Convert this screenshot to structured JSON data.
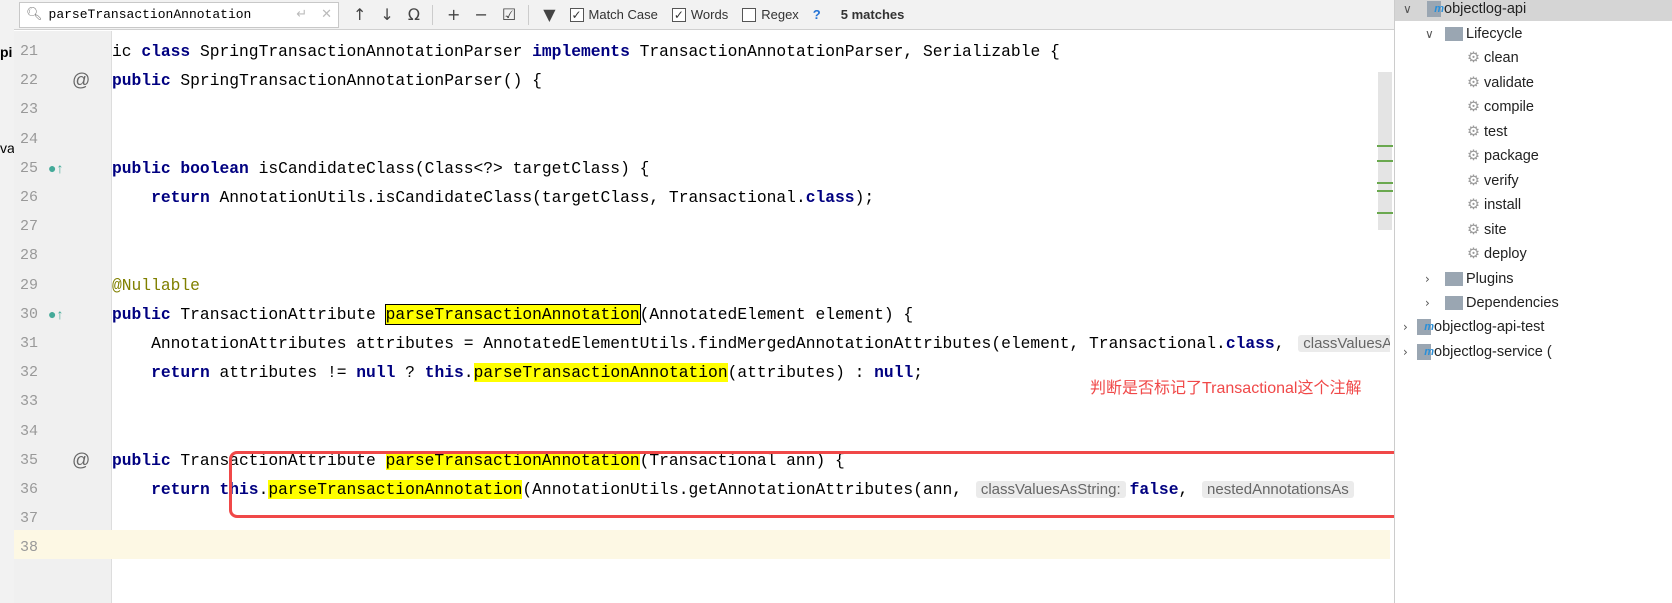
{
  "find_bar": {
    "query": "parseTransactionAnnotation",
    "match_case": {
      "label": "Match Case",
      "checked": true
    },
    "words": {
      "label": "Words",
      "checked": true
    },
    "regex": {
      "label": "Regex",
      "checked": false
    },
    "help": "?",
    "matches": "5 matches"
  },
  "left_strip": [
    "pi",
    "va"
  ],
  "code": [
    {
      "n": "21",
      "segs": [
        [
          "ic ",
          ""
        ],
        [
          "class",
          "kw"
        ],
        [
          " SpringTransactionAnnotationParser ",
          ""
        ],
        [
          "implements",
          "kw"
        ],
        [
          " TransactionAnnotationParser, Serializable {",
          ""
        ]
      ]
    },
    {
      "n": "22",
      "icon": "@",
      "segs": [
        [
          "public",
          "kw"
        ],
        [
          " SpringTransactionAnnotationParser() {",
          ""
        ]
      ]
    },
    {
      "n": "23",
      "segs": []
    },
    {
      "n": "24",
      "segs": []
    },
    {
      "n": "25",
      "icon": "implementing-method",
      "segs": [
        [
          "public boolean",
          "kw"
        ],
        [
          " isCandidateClass(Class<?> targetClass) {",
          ""
        ]
      ]
    },
    {
      "n": "26",
      "segs": [
        [
          "    ",
          ""
        ],
        [
          "return",
          "kw"
        ],
        [
          " AnnotationUtils.isCandidateClass(targetClass, Transactional.",
          ""
        ],
        [
          "class",
          "kw"
        ],
        [
          ");",
          ""
        ]
      ]
    },
    {
      "n": "27",
      "segs": []
    },
    {
      "n": "28",
      "segs": []
    },
    {
      "n": "29",
      "segs": [
        [
          "@Nullable",
          "ann"
        ]
      ]
    },
    {
      "n": "30",
      "icon": "implementing-method",
      "segs": [
        [
          "public",
          "kw"
        ],
        [
          " TransactionAttribute ",
          ""
        ],
        [
          "parseTransactionAnnotation",
          "hlbox"
        ],
        [
          "(AnnotatedElement element) {",
          ""
        ]
      ]
    },
    {
      "n": "31",
      "segs": [
        [
          "    AnnotationAttributes attributes = AnnotatedElementUtils.findMergedAnnotationAttributes(element, Transactional.",
          ""
        ],
        [
          "class",
          "kw"
        ],
        [
          ", ",
          ""
        ],
        [
          "classValuesAsString:",
          "hint"
        ]
      ]
    },
    {
      "n": "32",
      "segs": [
        [
          "    ",
          ""
        ],
        [
          "return",
          "kw"
        ],
        [
          " attributes != ",
          ""
        ],
        [
          "null",
          "kw"
        ],
        [
          " ? ",
          ""
        ],
        [
          "this",
          "kw"
        ],
        [
          ".",
          ""
        ],
        [
          "parseTransactionAnnotation",
          "hl"
        ],
        [
          "(attributes) : ",
          ""
        ],
        [
          "null",
          "kw"
        ],
        [
          ";",
          ""
        ]
      ]
    },
    {
      "n": "33",
      "segs": []
    },
    {
      "n": "34",
      "segs": []
    },
    {
      "n": "35",
      "icon": "@",
      "segs": [
        [
          "public",
          "kw"
        ],
        [
          " TransactionAttribute ",
          ""
        ],
        [
          "parseTransactionAnnotation",
          "hl"
        ],
        [
          "(Transactional ann) {",
          ""
        ]
      ]
    },
    {
      "n": "36",
      "segs": [
        [
          "    ",
          ""
        ],
        [
          "return this",
          "kw"
        ],
        [
          ".",
          ""
        ],
        [
          "parseTransactionAnnotation",
          "hl"
        ],
        [
          "(AnnotationUtils.getAnnotationAttributes(ann, ",
          ""
        ],
        [
          "classValuesAsString:",
          "hint"
        ],
        [
          "false",
          "kw"
        ],
        [
          ", ",
          ""
        ],
        [
          "nestedAnnotationsAs",
          "hint"
        ]
      ]
    },
    {
      "n": "37",
      "segs": []
    },
    {
      "n": "38",
      "segs": []
    }
  ],
  "annotation_note": "判断是否标记了Transactional这个注解",
  "maven_tree": {
    "root": "objectlog-api",
    "lifecycle": {
      "label": "Lifecycle",
      "goals": [
        "clean",
        "validate",
        "compile",
        "test",
        "package",
        "verify",
        "install",
        "site",
        "deploy"
      ]
    },
    "plugins": "Plugins",
    "dependencies": "Dependencies",
    "siblings": [
      "objectlog-api-test",
      "objectlog-service ("
    ]
  },
  "colors": {
    "highlight": "#ffff00",
    "keyword": "#000080",
    "annotation_box": "#f04848"
  }
}
